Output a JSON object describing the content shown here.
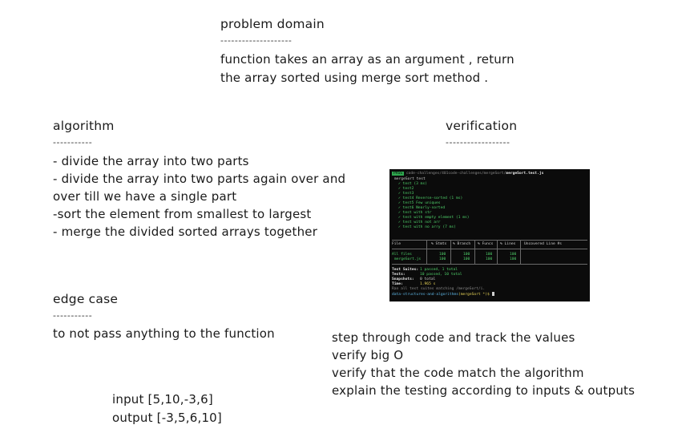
{
  "problem_domain": {
    "heading": "problem domain",
    "underline": "--------------------",
    "lines": [
      "function takes an array as an argument , return",
      "the array sorted using merge sort method ."
    ]
  },
  "algorithm": {
    "heading": "algorithm",
    "underline": "-----------",
    "lines": [
      "- divide the array into two parts",
      "- divide the array into two parts again over and",
      "over till we have a single part",
      "-sort the element from smallest to largest",
      "- merge the divided sorted arrays together"
    ]
  },
  "edge_case": {
    "heading": "edge case",
    "underline": "-----------",
    "lines": [
      "to not pass anything to the function"
    ]
  },
  "example": {
    "input": "input [5,10,-3,6]",
    "output": "output [-3,5,6,10]"
  },
  "verification": {
    "heading": "verification",
    "underline": "------------------",
    "lines": [
      "step through code and track the values",
      "verify big O",
      "verify that the code match the algorithm",
      "explain the testing according to inputs & outputs"
    ]
  },
  "terminal": {
    "badge": "PASS",
    "path": "code-challenges/401code-challenges/mergeSort/",
    "file": "mergeSort.test.js",
    "suite": "mergeSort test",
    "tests": [
      "test (3 ms)",
      "test2",
      "test3",
      "test4 Reverse-sorted (1 ms)",
      "test5 Few uniques",
      "test6 Nearly-sorted",
      "test with str",
      "test with empty element (1 ms)",
      "test with not arr",
      "test with no arry (7 ms)"
    ],
    "table_headers": [
      "File",
      "% Stmts",
      "% Branch",
      "% Funcs",
      "% Lines",
      "Uncovered Line #s"
    ],
    "table_rows": [
      [
        "All files",
        "100",
        "100",
        "100",
        "100",
        ""
      ],
      [
        "mergeSort.js",
        "100",
        "100",
        "100",
        "100",
        ""
      ]
    ],
    "summary": [
      {
        "label": "Test Suites:",
        "value": "1 passed, 1 total"
      },
      {
        "label": "Tests:",
        "value": "10 passed, 10 total"
      },
      {
        "label": "Snapshots:",
        "value": "0 total"
      },
      {
        "label": "Time:",
        "value": "1.965 s"
      }
    ],
    "ran_text": "Ran all test suites matching /mergeSort/i.",
    "prompt_dir": "data-structures-and-algorithms",
    "prompt_branch": "(mergeSort *)$"
  }
}
